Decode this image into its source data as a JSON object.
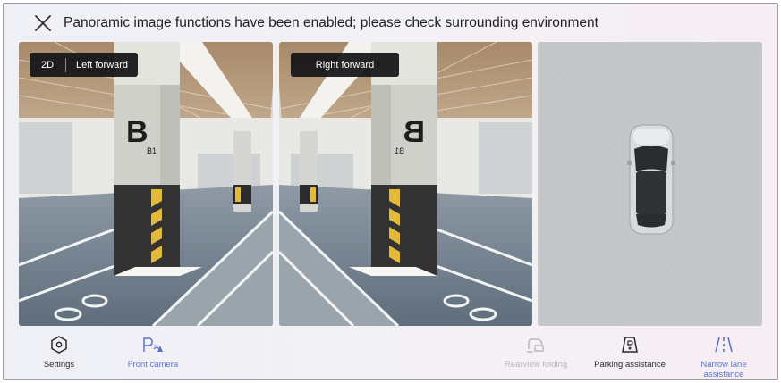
{
  "header": {
    "title": "Panoramic image functions have been enabled; please check surrounding environment",
    "close_icon": "close-icon"
  },
  "cameras": {
    "left": {
      "mode": "2D",
      "direction": "Left forward",
      "pillar_letter": "B",
      "pillar_sub": "B1"
    },
    "right": {
      "direction": "Right forward",
      "pillar_letter": "B",
      "pillar_sub": "B1"
    },
    "top_view": {
      "icon": "car-topview-icon"
    }
  },
  "toolbar": {
    "items": [
      {
        "label": "Settings",
        "icon": "hexagon-settings-icon",
        "state": "normal"
      },
      {
        "label": "Front camera",
        "icon": "front-camera-radar-icon",
        "state": "active"
      },
      {
        "label": "Rearview folding",
        "icon": "mirror-fold-icon",
        "state": "disabled"
      },
      {
        "label": "Parking assistance",
        "icon": "parking-assist-icon",
        "state": "normal"
      },
      {
        "label": "Narrow lane assistance",
        "icon": "narrow-lane-icon",
        "state": "active"
      }
    ]
  },
  "colors": {
    "accent": "#5b74cf",
    "disabled": "#b7b7bd",
    "text": "#202124",
    "pill_bg": "#121216"
  }
}
